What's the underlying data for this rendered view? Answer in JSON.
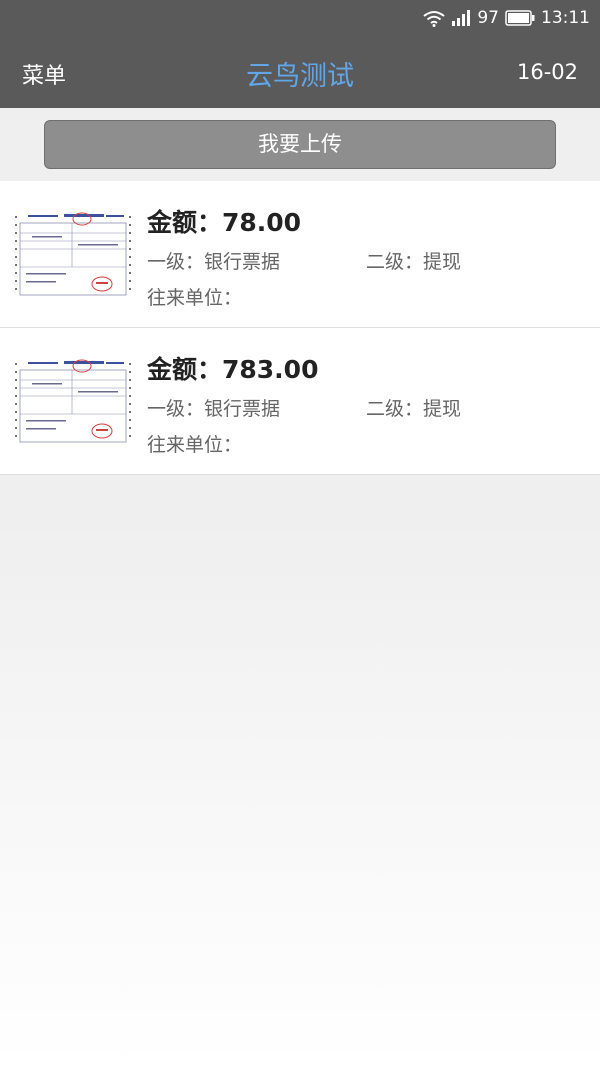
{
  "status": {
    "battery": "97",
    "time": "13:11"
  },
  "nav": {
    "menu_label": "菜单",
    "title": "云鸟测试",
    "date": "16-02",
    "title_color": "#62a6e8"
  },
  "upload_label": "我要上传",
  "records": [
    {
      "amount": "金额：78.00",
      "level1": "一级：银行票据",
      "level2": "二级：提现",
      "partner": "往来单位：",
      "thumbnail_icon": "invoice-thumbnail-icon"
    },
    {
      "amount": "金额：783.00",
      "level1": "一级：银行票据",
      "level2": "二级：提现",
      "partner": "往来单位：",
      "thumbnail_icon": "invoice-thumbnail-icon"
    }
  ]
}
